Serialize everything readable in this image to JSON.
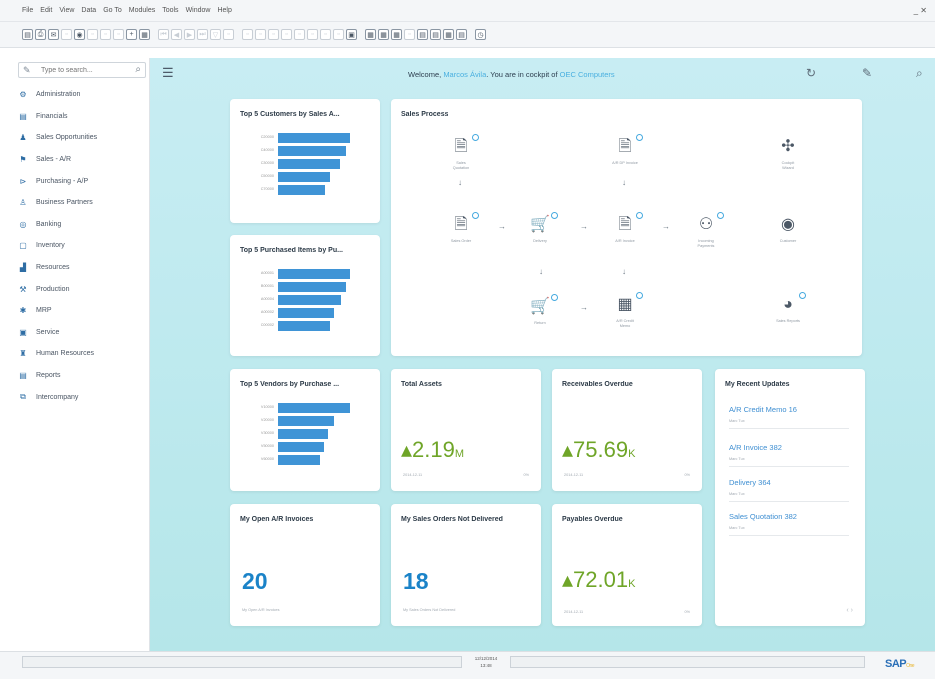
{
  "window": {
    "menu": [
      "File",
      "Edit",
      "View",
      "Data",
      "Go To",
      "Modules",
      "Tools",
      "Window",
      "Help"
    ],
    "controls": "_ ✕"
  },
  "sidebar": {
    "search_placeholder": "Type to search...",
    "items": [
      {
        "label": "Administration",
        "icon": "admin-icon"
      },
      {
        "label": "Financials",
        "icon": "financials-icon"
      },
      {
        "label": "Sales Opportunities",
        "icon": "opportunities-icon"
      },
      {
        "label": "Sales - A/R",
        "icon": "sales-icon"
      },
      {
        "label": "Purchasing - A/P",
        "icon": "purchasing-icon"
      },
      {
        "label": "Business Partners",
        "icon": "partners-icon"
      },
      {
        "label": "Banking",
        "icon": "banking-icon"
      },
      {
        "label": "Inventory",
        "icon": "inventory-icon"
      },
      {
        "label": "Resources",
        "icon": "resources-icon"
      },
      {
        "label": "Production",
        "icon": "production-icon"
      },
      {
        "label": "MRP",
        "icon": "mrp-icon"
      },
      {
        "label": "Service",
        "icon": "service-icon"
      },
      {
        "label": "Human Resources",
        "icon": "hr-icon"
      },
      {
        "label": "Reports",
        "icon": "reports-icon"
      },
      {
        "label": "Intercompany",
        "icon": "intercompany-icon"
      }
    ]
  },
  "header": {
    "welcome_prefix": "Welcome,",
    "user": "Marcos Ávila",
    "welcome_mid": "You are in cockpit of",
    "company": "OEC Computers"
  },
  "cards": {
    "customers": {
      "title": "Top 5 Customers by Sales A...",
      "rows": [
        {
          "label": "C20000",
          "value": 1.0
        },
        {
          "label": "C40000",
          "value": 0.95
        },
        {
          "label": "C30000",
          "value": 0.86
        },
        {
          "label": "C50000",
          "value": 0.72
        },
        {
          "label": "C70000",
          "value": 0.65
        }
      ]
    },
    "items": {
      "title": "Top 5 Purchased Items by Pu...",
      "rows": [
        {
          "label": "A00001",
          "value": 1.0
        },
        {
          "label": "B00001",
          "value": 0.95
        },
        {
          "label": "A00004",
          "value": 0.88
        },
        {
          "label": "A00002",
          "value": 0.78
        },
        {
          "label": "C00002",
          "value": 0.72
        }
      ]
    },
    "vendors": {
      "title": "Top 5 Vendors by Purchase ...",
      "rows": [
        {
          "label": "V10000",
          "value": 1.0
        },
        {
          "label": "V20000",
          "value": 0.78
        },
        {
          "label": "V30000",
          "value": 0.7
        },
        {
          "label": "V50000",
          "value": 0.64
        },
        {
          "label": "V60000",
          "value": 0.58
        }
      ]
    },
    "process": {
      "title": "Sales Process",
      "nodes": {
        "sq": "Sales\nQuotation",
        "ardp": "A/R DP Invoice",
        "cw": "Cockpit\nWizard",
        "so": "Sales Order",
        "del": "Delivery",
        "ari": "A/R Invoice",
        "ip": "Incoming\nPayments",
        "cust": "Customer",
        "ret": "Return",
        "arcm": "A/R Credit\nMemo",
        "sr": "Sales Reports"
      }
    },
    "assets": {
      "title": "Total Assets",
      "value": "2.19",
      "unit": "M",
      "date": "2014-12-11",
      "trend": "0%"
    },
    "receivables": {
      "title": "Receivables Overdue",
      "value": "75.69",
      "unit": "K",
      "date": "2014-12-11",
      "trend": "0%"
    },
    "payables": {
      "title": "Payables Overdue",
      "value": "72.01",
      "unit": "K",
      "date": "2014-12-11",
      "trend": "0%"
    },
    "open_ar": {
      "title": "My Open A/R Invoices",
      "count": "20",
      "sub": "My Open A/R Invoices"
    },
    "sales_orders": {
      "title": "My Sales Orders Not Delivered",
      "count": "18",
      "sub": "My Sales Orders Not Delivered"
    },
    "updates": {
      "title": "My Recent Updates",
      "items": [
        {
          "link": "A/R Credit Memo 16",
          "user": "Marc Tux"
        },
        {
          "link": "A/R Invoice 382",
          "user": "Marc Tux"
        },
        {
          "link": "Delivery 364",
          "user": "Marc Tux"
        },
        {
          "link": "Sales Quotation 382",
          "user": "Marc Tux"
        }
      ],
      "pager": "‹  ›"
    }
  },
  "status": {
    "date": "12/12/2014",
    "time": "13:48",
    "logo": "SAP",
    "logo_sub": "One"
  },
  "colors": {
    "accent": "#3f94d6",
    "kpi_green": "#6fa528",
    "count_blue": "#1b83c8",
    "link": "#3f8fd2",
    "bg_gradient_top": "#c8edf3",
    "bg_gradient_bottom": "#b5e6e9"
  }
}
